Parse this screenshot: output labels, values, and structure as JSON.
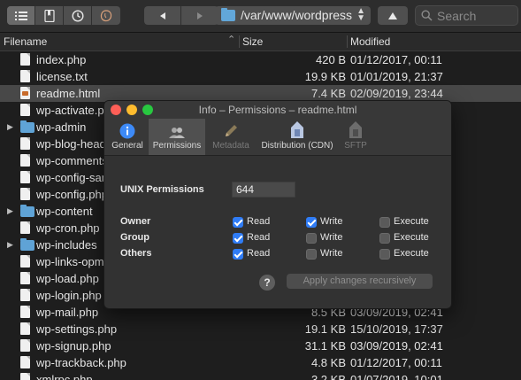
{
  "toolbar": {
    "view_buttons": [
      "list-view-icon",
      "bookmarks-icon",
      "history-icon",
      "bonjour-icon"
    ],
    "nav_buttons": [
      "back-icon",
      "forward-icon"
    ],
    "path": "/var/www/wordpress",
    "search_placeholder": "Search"
  },
  "columns": {
    "filename": "Filename",
    "size": "Size",
    "modified": "Modified"
  },
  "files": [
    {
      "name": "index.php",
      "size": "420 B",
      "modified": "01/12/2017, 00:11",
      "kind": "file"
    },
    {
      "name": "license.txt",
      "size": "19.9 KB",
      "modified": "01/01/2019, 21:37",
      "kind": "file"
    },
    {
      "name": "readme.html",
      "size": "7.4 KB",
      "modified": "02/09/2019, 23:44",
      "kind": "html",
      "selected": true
    },
    {
      "name": "wp-activate.php",
      "size": "",
      "modified": "",
      "kind": "file"
    },
    {
      "name": "wp-admin",
      "size": "",
      "modified": "",
      "kind": "folder"
    },
    {
      "name": "wp-blog-header.php",
      "size": "",
      "modified": "",
      "kind": "file"
    },
    {
      "name": "wp-comments-post.php",
      "size": "",
      "modified": "",
      "kind": "file"
    },
    {
      "name": "wp-config-sample.php",
      "size": "",
      "modified": "",
      "kind": "file"
    },
    {
      "name": "wp-config.php",
      "size": "",
      "modified": "",
      "kind": "file"
    },
    {
      "name": "wp-content",
      "size": "",
      "modified": "",
      "kind": "folder"
    },
    {
      "name": "wp-cron.php",
      "size": "",
      "modified": "",
      "kind": "file"
    },
    {
      "name": "wp-includes",
      "size": "",
      "modified": "",
      "kind": "folder"
    },
    {
      "name": "wp-links-opml.php",
      "size": "",
      "modified": "",
      "kind": "file"
    },
    {
      "name": "wp-load.php",
      "size": "",
      "modified": "",
      "kind": "file"
    },
    {
      "name": "wp-login.php",
      "size": "",
      "modified": "",
      "kind": "file"
    },
    {
      "name": "wp-mail.php",
      "size": "8.5 KB",
      "modified": "03/09/2019, 02:41",
      "kind": "file"
    },
    {
      "name": "wp-settings.php",
      "size": "19.1 KB",
      "modified": "15/10/2019, 17:37",
      "kind": "file"
    },
    {
      "name": "wp-signup.php",
      "size": "31.1 KB",
      "modified": "03/09/2019, 02:41",
      "kind": "file"
    },
    {
      "name": "wp-trackback.php",
      "size": "4.8 KB",
      "modified": "01/12/2017, 00:11",
      "kind": "file"
    },
    {
      "name": "xmlrpc.php",
      "size": "3.2 KB",
      "modified": "01/07/2019, 10:01",
      "kind": "file"
    }
  ],
  "dialog": {
    "title": "Info – Permissions – readme.html",
    "tabs": [
      {
        "label": "General",
        "icon": "info-icon",
        "active": false,
        "disabled": false
      },
      {
        "label": "Permissions",
        "icon": "people-icon",
        "active": true,
        "disabled": false
      },
      {
        "label": "Metadata",
        "icon": "pencil-icon",
        "active": false,
        "disabled": true
      },
      {
        "label": "Distribution (CDN)",
        "icon": "cdn-icon",
        "active": false,
        "disabled": false
      },
      {
        "label": "SFTP",
        "icon": "sftp-icon",
        "active": false,
        "disabled": true
      }
    ],
    "unix_label": "UNIX Permissions",
    "unix_value": "644",
    "perm_headers": [
      "Read",
      "Write",
      "Execute"
    ],
    "perms": [
      {
        "who": "Owner",
        "read": true,
        "write": true,
        "execute": false
      },
      {
        "who": "Group",
        "read": true,
        "write": false,
        "execute": false
      },
      {
        "who": "Others",
        "read": true,
        "write": false,
        "execute": false
      }
    ],
    "help_label": "?",
    "apply_label": "Apply changes recursively"
  }
}
